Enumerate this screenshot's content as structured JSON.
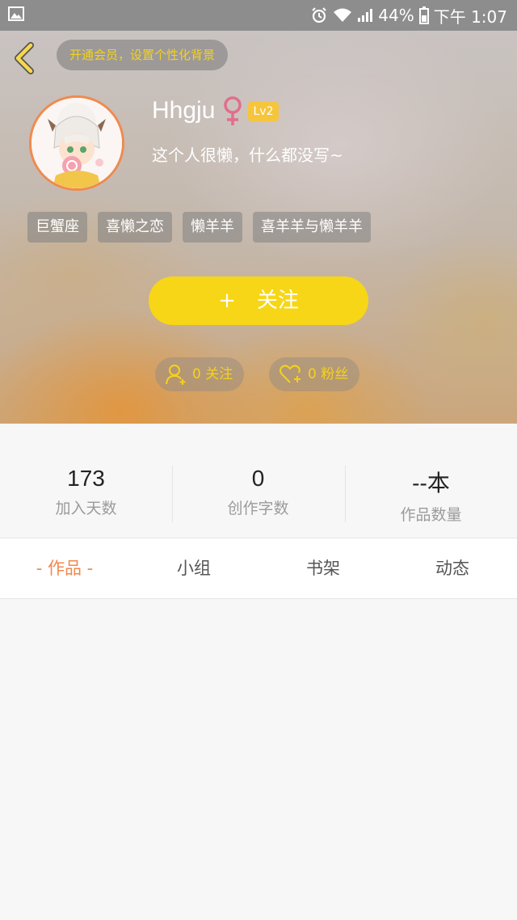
{
  "status_bar": {
    "battery": "44%",
    "time": "下午 1:07"
  },
  "header": {
    "vip_prompt": "开通会员，设置个性化背景"
  },
  "profile": {
    "username": "Hhgju",
    "level": "Lv2",
    "bio": "这个人很懒，什么都没写~",
    "tags": [
      "巨蟹座",
      "喜懒之恋",
      "懒羊羊",
      "喜羊羊与懒羊羊"
    ],
    "follow_plus": "+",
    "follow_label": "关注",
    "following_text": "0 关注",
    "fans_text": "0 粉丝",
    "accent_color": "#f7d617"
  },
  "stats": [
    {
      "value": "173",
      "label": "加入天数"
    },
    {
      "value": "0",
      "label": "创作字数"
    },
    {
      "value": "--本",
      "label": "作品数量"
    }
  ],
  "tabs": [
    {
      "label": "- 作品 -"
    },
    {
      "label": "小组"
    },
    {
      "label": "书架"
    },
    {
      "label": "动态"
    }
  ],
  "colors": {
    "active_tab": "#f0884d",
    "gender_icon": "#e26d8e",
    "vip_text": "#f5d21a"
  }
}
